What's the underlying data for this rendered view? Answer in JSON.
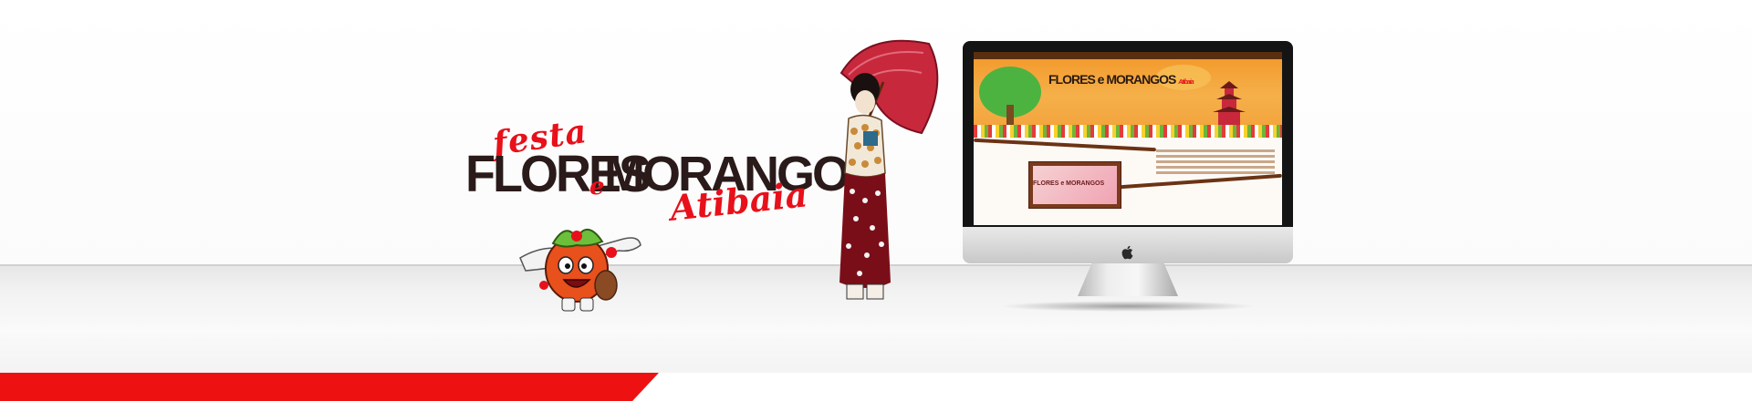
{
  "logo": {
    "festa": "festa",
    "flores": "FLORES",
    "e": "e",
    "morangos": "MORANGOS",
    "atibaia": "Atibaia"
  },
  "monitor_site": {
    "title_main": "FLORES e MORANGOS",
    "title_sub": "Atibaia",
    "box_title": "FLORES e MORANGOS"
  },
  "colors": {
    "brand_red": "#ee1111",
    "dark_text": "#2a1a1a",
    "hero_orange": "#f39b2e"
  },
  "icons": [
    "apple-logo-icon"
  ]
}
